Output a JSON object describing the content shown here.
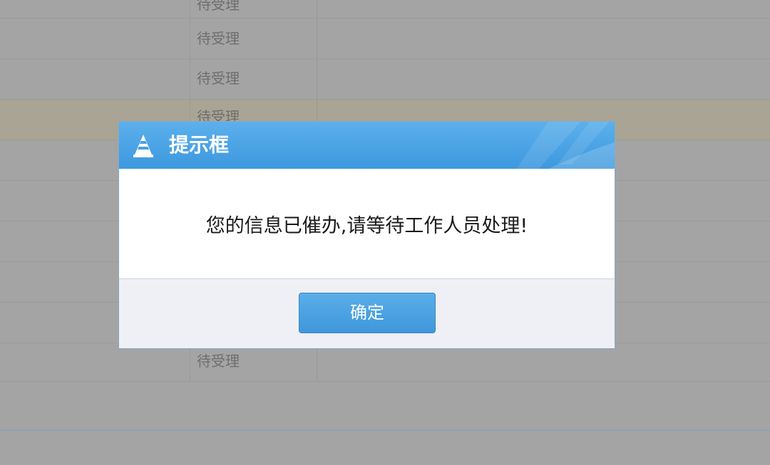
{
  "background_table": {
    "rows": [
      {
        "status": "待受理"
      },
      {
        "status": "待受理"
      },
      {
        "status": "待受理"
      },
      {
        "status": "待受理"
      },
      {
        "status": ""
      },
      {
        "status": ""
      },
      {
        "status": ""
      },
      {
        "status": ""
      },
      {
        "status": ""
      },
      {
        "status": "待受理"
      }
    ]
  },
  "dialog": {
    "title": "提示框",
    "icon": "traffic-cone-icon",
    "message": "您的信息已催办,请等待工作人员处理!",
    "confirm_label": "确定"
  },
  "colors": {
    "header_blue": "#3d98de",
    "button_blue": "#4a9fe2",
    "mask_gray": "#a4a4a4",
    "highlight_row": "#a9a493"
  }
}
